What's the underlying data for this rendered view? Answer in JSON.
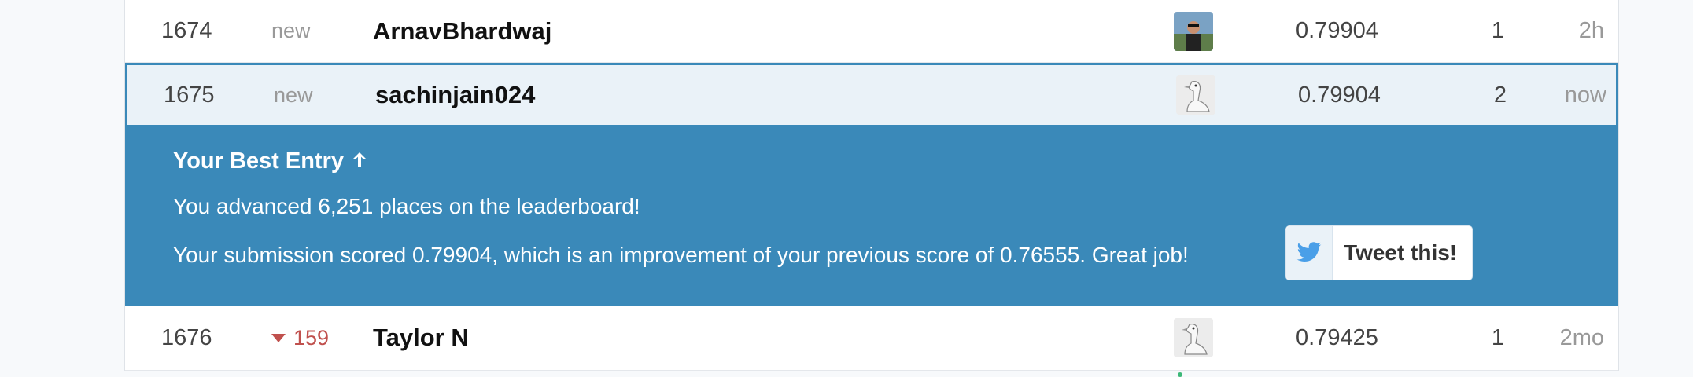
{
  "rows": [
    {
      "rank": "1674",
      "change": "new",
      "team": "ArnavBhardwaj",
      "score": "0.79904",
      "entries": "1",
      "last": "2h",
      "avatar": "photo-avatar-icon"
    },
    {
      "rank": "1675",
      "change": "new",
      "team": "sachinjain024",
      "score": "0.79904",
      "entries": "2",
      "last": "now",
      "avatar": "goose-avatar-icon"
    },
    {
      "rank": "1676",
      "change": "159",
      "change_dir": "down",
      "team": "Taylor N",
      "score": "0.79425",
      "entries": "1",
      "last": "2mo",
      "avatar": "goose-avatar-icon"
    }
  ],
  "banner": {
    "title": "Your Best Entry",
    "line1": "You advanced 6,251 places on the leaderboard!",
    "line2": "Your submission scored 0.79904, which is an improvement of your previous score of 0.76555. Great job!",
    "tweet_label": "Tweet this!"
  },
  "colors": {
    "accent": "#3a89b9",
    "highlight": "#eaf2f8",
    "down": "#c0504d",
    "twitter": "#4a9fe8"
  }
}
